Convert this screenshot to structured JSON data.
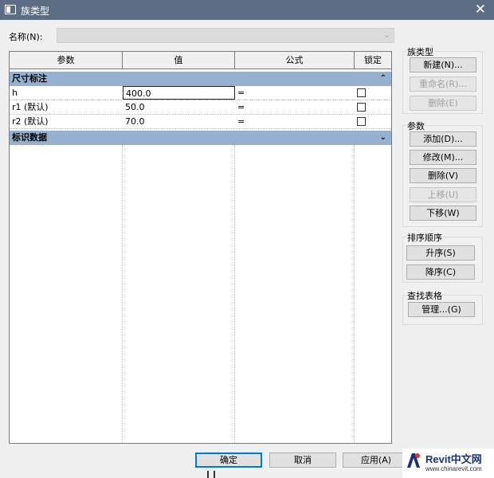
{
  "window": {
    "title": "族类型",
    "close_glyph": "✕"
  },
  "name_field": {
    "label": "名称(N):",
    "value": ""
  },
  "table": {
    "headers": [
      "参数",
      "值",
      "公式",
      "锁定"
    ],
    "groups": [
      {
        "label": "尺寸标注",
        "toggle": "⌃",
        "rows": [
          {
            "param": "h",
            "value": "400.0",
            "formula": "=",
            "locked": false
          },
          {
            "param": "r1 (默认)",
            "value": "50.0",
            "formula": "=",
            "locked": false
          },
          {
            "param": "r2 (默认)",
            "value": "70.0",
            "formula": "=",
            "locked": false
          }
        ]
      },
      {
        "label": "标识数据",
        "toggle": "⌄",
        "rows": []
      }
    ]
  },
  "family_types_panel": {
    "title": "族类型",
    "new_label": "新建(N)...",
    "rename_label": "重命名(R)...",
    "delete_label": "删除(E)"
  },
  "parameters_panel": {
    "title": "参数",
    "add_label": "添加(D)...",
    "modify_label": "修改(M)...",
    "delete_label": "删除(V)",
    "move_up_label": "上移(U)",
    "move_down_label": "下移(W)"
  },
  "sort_panel": {
    "title": "排序顺序",
    "ascending_label": "升序(S)",
    "descending_label": "降序(C)"
  },
  "lookup_panel": {
    "title": "查找表格",
    "manage_label": "管理...(G)"
  },
  "footer": {
    "ok_label": "确定",
    "cancel_label": "取消",
    "apply_label": "应用(A)"
  },
  "watermark": {
    "brand": "Revit中文网",
    "url": "www.chinarevit.com"
  }
}
